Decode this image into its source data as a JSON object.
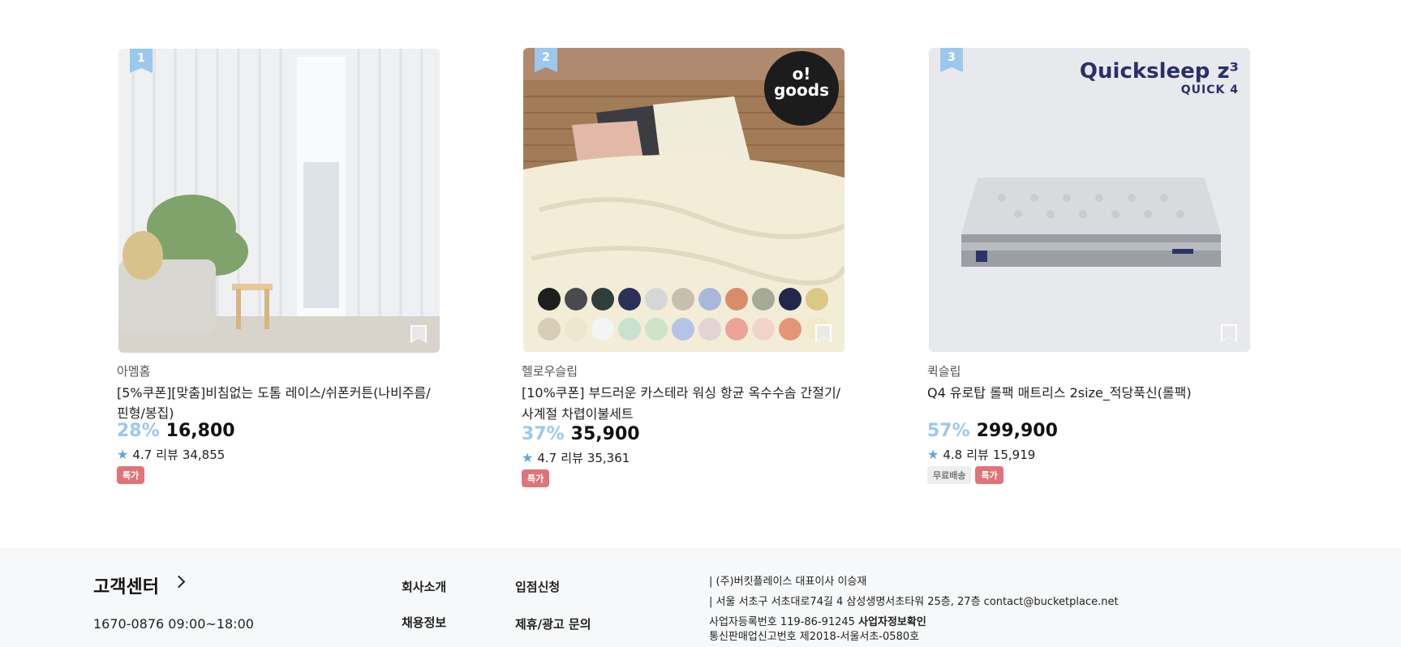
{
  "products": [
    {
      "rank": "1",
      "brand": "아멤홈",
      "title": "[5%쿠폰][맞춤]비침없는 도톰 레이스/쉬폰커튼(나비주름/핀형/봉집)",
      "discount": "28%",
      "price": "16,800",
      "rating": "4.7",
      "review_label": "리뷰",
      "review_count": "34,855",
      "badges": [
        "특가"
      ]
    },
    {
      "rank": "2",
      "brand": "헬로우슬립",
      "title": "[10%쿠폰] 부드러운 카스테라 워싱 항균 옥수수솜 간절기/사계절 차렵이불세트",
      "discount": "37%",
      "price": "35,900",
      "rating": "4.7",
      "review_label": "리뷰",
      "review_count": "35,361",
      "badges": [
        "특가"
      ],
      "logo_text_1": "o!",
      "logo_text_2": "goods"
    },
    {
      "rank": "3",
      "brand": "퀵슬립",
      "title": "Q4 유로탑 롤팩 매트리스 2size_적당푹신(롤팩)",
      "discount": "57%",
      "price": "299,900",
      "rating": "4.8",
      "review_label": "리뷰",
      "review_count": "15,919",
      "badges": [
        "무료배송",
        "특가"
      ],
      "logo_line_1": "Quicksleep z³",
      "logo_line_2": "QUICK 4"
    }
  ],
  "footer": {
    "cs_title": "고객센터",
    "cs_hours": "1670-0876 09:00~18:00",
    "links": {
      "about": "회사소개",
      "careers": "채용정보",
      "apply": "입점신청",
      "partner": "제휴/광고 문의"
    },
    "info": {
      "line1": "(주)버킷플레이스 대표이사 이승재",
      "line2": "서울 서초구 서초대로74길 4 삼성생명서초타워 25층, 27층 contact@bucketplace.net",
      "biz_no": "사업자등록번호 119-86-91245",
      "biz_link": "사업자정보확인",
      "mail_order": "통신판매업신고번호 제2018-서울서초-0580호"
    }
  },
  "colors": {
    "discount": "#9cc8ec",
    "rank_badge": "#9cc8ec",
    "sale_badge": "#e0747a",
    "star": "#5aa9e6"
  }
}
